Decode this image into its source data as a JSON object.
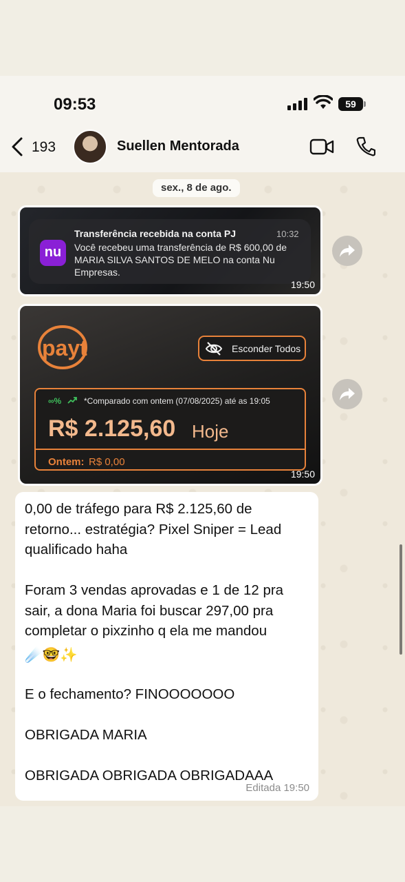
{
  "status_bar": {
    "time": "09:53",
    "battery": "59"
  },
  "header": {
    "back_count": "193",
    "contact_name": "Suellen Mentorada"
  },
  "date_chip": "sex., 8 de ago.",
  "notification_message": {
    "app_icon_text": "nu",
    "title": "Transferência recebida na conta PJ",
    "time": "10:32",
    "body": "Você recebeu uma transferência de R$ 600,00 de MARIA SILVA SANTOS DE MELO na conta Nu Empresas.",
    "sent_time": "19:50"
  },
  "payt_message": {
    "logo_text": "payt",
    "hide_all_label": "Esconder Todos",
    "trend_label": "∞%",
    "compare_text": "*Comparado com ontem (07/08/2025) até as 19:05",
    "amount": "R$ 2.125,60",
    "amount_suffix": "Hoje",
    "yesterday_label": "Ontem:",
    "yesterday_value": "R$ 0,00",
    "sent_time": "19:50"
  },
  "text_message": {
    "paragraph_1": "0,00 de tráfego para R$ 2.125,60 de retorno... estratégia? Pixel Sniper = Lead qualificado haha",
    "paragraph_2": "Foram 3 vendas aprovadas e 1 de 12 pra sair, a dona Maria foi buscar 297,00 pra completar o pixzinho q ela me mandou",
    "emojis": "☄️🤓✨",
    "paragraph_3": "E o fechamento? FINOOOOOOO",
    "paragraph_4": "OBRIGADA MARIA",
    "paragraph_5": "OBRIGADA OBRIGADA OBRIGADAAA",
    "meta": "Editada 19:50"
  },
  "colors": {
    "payt_orange": "#e8823a",
    "nubank_purple": "#8a20d6",
    "chat_background": "#efe9dc"
  }
}
